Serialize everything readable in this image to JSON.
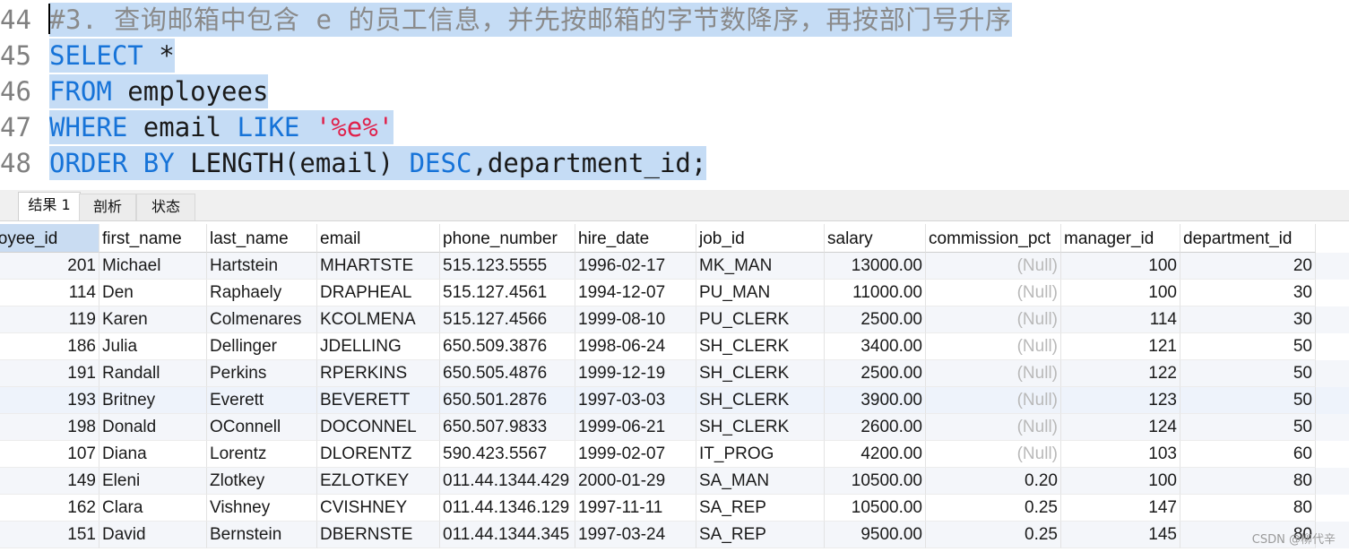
{
  "editor": {
    "lines": [
      {
        "num": "44",
        "parts": [
          {
            "t": "#3. 查询邮箱中包含 e 的员工信息，并先按邮箱的字节数降序，再按部门号升序",
            "c": "cmt"
          }
        ]
      },
      {
        "num": "45",
        "parts": [
          {
            "t": "SELECT",
            "c": "kw"
          },
          {
            "t": " *",
            "c": ""
          }
        ]
      },
      {
        "num": "46",
        "parts": [
          {
            "t": "FROM",
            "c": "kw"
          },
          {
            "t": " employees",
            "c": ""
          }
        ]
      },
      {
        "num": "47",
        "parts": [
          {
            "t": "WHERE",
            "c": "kw"
          },
          {
            "t": " email ",
            "c": ""
          },
          {
            "t": "LIKE",
            "c": "kw"
          },
          {
            "t": " ",
            "c": ""
          },
          {
            "t": "'%e%'",
            "c": "str"
          }
        ]
      },
      {
        "num": "48",
        "parts": [
          {
            "t": "ORDER BY",
            "c": "kw"
          },
          {
            "t": " LENGTH(email) ",
            "c": ""
          },
          {
            "t": "DESC",
            "c": "kw"
          },
          {
            "t": ",department_id;",
            "c": ""
          }
        ]
      }
    ]
  },
  "tabs": {
    "result": "结果 1",
    "profile": "剖析",
    "status": "状态"
  },
  "grid": {
    "columns": [
      "ployee_id",
      "first_name",
      "last_name",
      "email",
      "phone_number",
      "hire_date",
      "job_id",
      "salary",
      "commission_pct",
      "manager_id",
      "department_id"
    ],
    "null_text": "(Null)",
    "rows": [
      [
        "201",
        "Michael",
        "Hartstein",
        "MHARTSTE",
        "515.123.5555",
        "1996-02-17",
        "MK_MAN",
        "13000.00",
        null,
        "100",
        "20"
      ],
      [
        "114",
        "Den",
        "Raphaely",
        "DRAPHEAL",
        "515.127.4561",
        "1994-12-07",
        "PU_MAN",
        "11000.00",
        null,
        "100",
        "30"
      ],
      [
        "119",
        "Karen",
        "Colmenares",
        "KCOLMENA",
        "515.127.4566",
        "1999-08-10",
        "PU_CLERK",
        "2500.00",
        null,
        "114",
        "30"
      ],
      [
        "186",
        "Julia",
        "Dellinger",
        "JDELLING",
        "650.509.3876",
        "1998-06-24",
        "SH_CLERK",
        "3400.00",
        null,
        "121",
        "50"
      ],
      [
        "191",
        "Randall",
        "Perkins",
        "RPERKINS",
        "650.505.4876",
        "1999-12-19",
        "SH_CLERK",
        "2500.00",
        null,
        "122",
        "50"
      ],
      [
        "193",
        "Britney",
        "Everett",
        "BEVERETT",
        "650.501.2876",
        "1997-03-03",
        "SH_CLERK",
        "3900.00",
        null,
        "123",
        "50"
      ],
      [
        "198",
        "Donald",
        "OConnell",
        "DOCONNEL",
        "650.507.9833",
        "1999-06-21",
        "SH_CLERK",
        "2600.00",
        null,
        "124",
        "50"
      ],
      [
        "107",
        "Diana",
        "Lorentz",
        "DLORENTZ",
        "590.423.5567",
        "1999-02-07",
        "IT_PROG",
        "4200.00",
        null,
        "103",
        "60"
      ],
      [
        "149",
        "Eleni",
        "Zlotkey",
        "EZLOTKEY",
        "011.44.1344.429",
        "2000-01-29",
        "SA_MAN",
        "10500.00",
        "0.20",
        "100",
        "80"
      ],
      [
        "162",
        "Clara",
        "Vishney",
        "CVISHNEY",
        "011.44.1346.129",
        "1997-11-11",
        "SA_REP",
        "10500.00",
        "0.25",
        "147",
        "80"
      ],
      [
        "151",
        "David",
        "Bernstein",
        "DBERNSTE",
        "011.44.1344.345",
        "1997-03-24",
        "SA_REP",
        "9500.00",
        "0.25",
        "145",
        "80"
      ]
    ]
  },
  "watermark": "CSDN @柳代辛"
}
